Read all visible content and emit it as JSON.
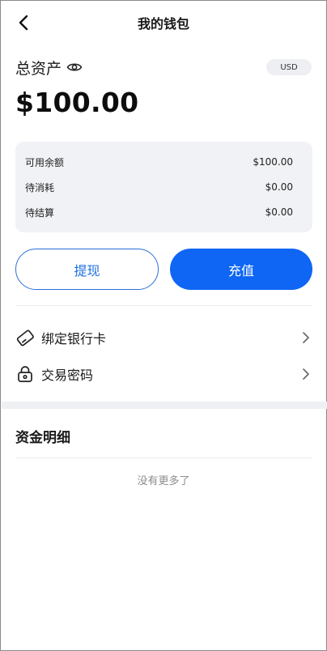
{
  "header": {
    "title": "我的钱包"
  },
  "assets": {
    "label": "总资产",
    "currency": "USD",
    "total": "$100.00"
  },
  "balances": [
    {
      "label": "可用余额",
      "value": "$100.00"
    },
    {
      "label": "待消耗",
      "value": "$0.00"
    },
    {
      "label": "待结算",
      "value": "$0.00"
    }
  ],
  "actions": {
    "withdraw_label": "提现",
    "recharge_label": "充值"
  },
  "menu": [
    {
      "label": "绑定银行卡",
      "icon": "bank-card-icon"
    },
    {
      "label": "交易密码",
      "icon": "lock-icon"
    }
  ],
  "details": {
    "title": "资金明细",
    "empty_text": "没有更多了"
  },
  "colors": {
    "primary": "#0f66f5",
    "card_bg": "#f1f2f5",
    "section_gap": "#eef0f4"
  }
}
